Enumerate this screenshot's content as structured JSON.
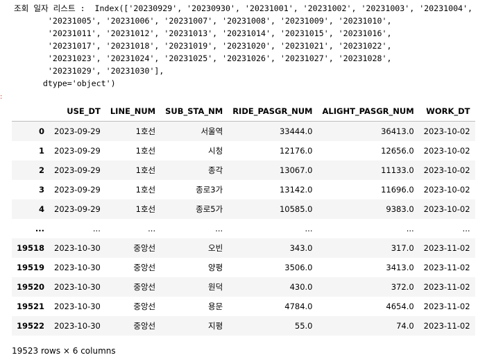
{
  "stream_output": {
    "lines": [
      "조회 일자 리스트 :  Index(['20230929', '20230930', '20231001', '20231002', '20231003', '20231004',",
      "       '20231005', '20231006', '20231007', '20231008', '20231009', '20231010',",
      "       '20231011', '20231012', '20231013', '20231014', '20231015', '20231016',",
      "       '20231017', '20231018', '20231019', '20231020', '20231021', '20231022',",
      "       '20231023', '20231024', '20231025', '20231026', '20231027', '20231028',",
      "       '20231029', '20231030'],",
      "      dtype='object')"
    ]
  },
  "output_marker": ":",
  "dataframe": {
    "columns": [
      "",
      "USE_DT",
      "LINE_NUM",
      "SUB_STA_NM",
      "RIDE_PASGR_NUM",
      "ALIGHT_PASGR_NUM",
      "WORK_DT"
    ],
    "rows": [
      [
        "0",
        "2023-09-29",
        "1호선",
        "서울역",
        "33444.0",
        "36413.0",
        "2023-10-02"
      ],
      [
        "1",
        "2023-09-29",
        "1호선",
        "시청",
        "12176.0",
        "12656.0",
        "2023-10-02"
      ],
      [
        "2",
        "2023-09-29",
        "1호선",
        "종각",
        "13067.0",
        "11133.0",
        "2023-10-02"
      ],
      [
        "3",
        "2023-09-29",
        "1호선",
        "종로3가",
        "13142.0",
        "11696.0",
        "2023-10-02"
      ],
      [
        "4",
        "2023-09-29",
        "1호선",
        "종로5가",
        "10585.0",
        "9383.0",
        "2023-10-02"
      ],
      [
        "...",
        "...",
        "...",
        "...",
        "...",
        "...",
        "..."
      ],
      [
        "19518",
        "2023-10-30",
        "중앙선",
        "오빈",
        "343.0",
        "317.0",
        "2023-11-02"
      ],
      [
        "19519",
        "2023-10-30",
        "중앙선",
        "양평",
        "3506.0",
        "3413.0",
        "2023-11-02"
      ],
      [
        "19520",
        "2023-10-30",
        "중앙선",
        "원덕",
        "430.0",
        "372.0",
        "2023-11-02"
      ],
      [
        "19521",
        "2023-10-30",
        "중앙선",
        "용문",
        "4784.0",
        "4654.0",
        "2023-11-02"
      ],
      [
        "19522",
        "2023-10-30",
        "중앙선",
        "지평",
        "55.0",
        "74.0",
        "2023-11-02"
      ]
    ],
    "summary": "19523 rows × 6 columns"
  }
}
